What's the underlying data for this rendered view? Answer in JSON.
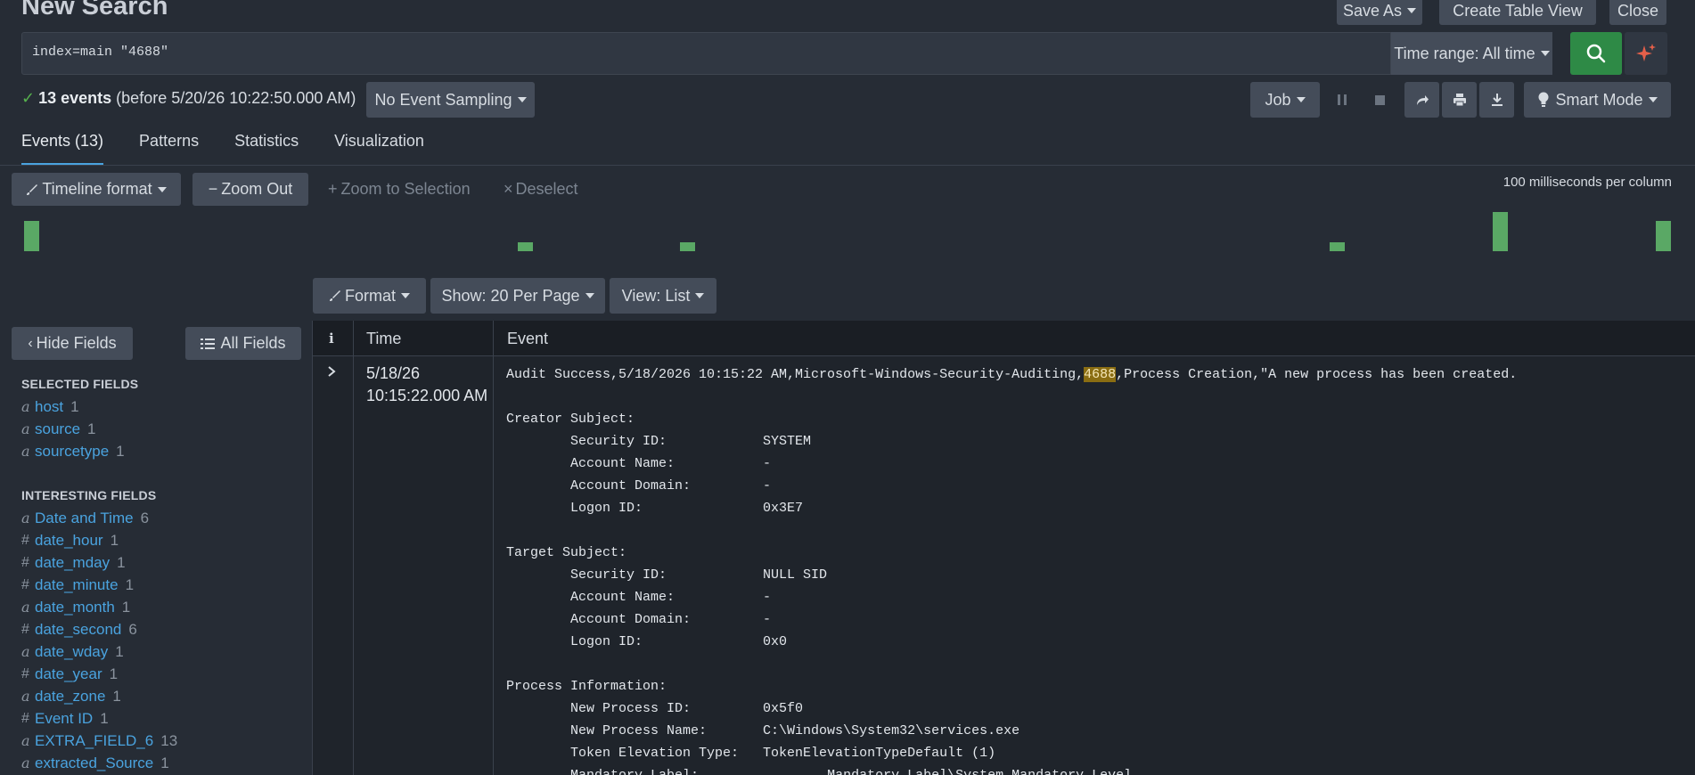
{
  "page": {
    "title": "New Search",
    "save_as": "Save As",
    "create_table_view": "Create Table View",
    "close": "Close"
  },
  "search": {
    "query": "index=main \"4688\"",
    "time_range": "Time range: All time"
  },
  "status": {
    "events_count": "13 events",
    "events_note": "(before 5/20/26 10:22:50.000 AM)",
    "sampling": "No Event Sampling",
    "job": "Job",
    "smart_mode": "Smart Mode"
  },
  "tabs": [
    {
      "label": "Events (13)",
      "active": true
    },
    {
      "label": "Patterns",
      "active": false
    },
    {
      "label": "Statistics",
      "active": false
    },
    {
      "label": "Visualization",
      "active": false
    }
  ],
  "timeline": {
    "format": "Timeline format",
    "zoom_out": "Zoom Out",
    "zoom_to_selection": "Zoom to Selection",
    "deselect": "Deselect",
    "scale_label": "100 milliseconds per column",
    "bars": [
      {
        "level": 1.0
      },
      {
        "level": 0.3
      },
      {
        "level": 0.3
      },
      {
        "level": 0.3
      },
      {
        "level": 1.3
      },
      {
        "level": 1.0
      }
    ]
  },
  "results_toolbar": {
    "format": "Format",
    "per_page": "Show: 20 Per Page",
    "view": "View: List"
  },
  "fields": {
    "hide_fields": "Hide Fields",
    "all_fields": "All Fields",
    "selected_header": "SELECTED FIELDS",
    "selected": [
      {
        "type": "a",
        "name": "host",
        "count": "1"
      },
      {
        "type": "a",
        "name": "source",
        "count": "1"
      },
      {
        "type": "a",
        "name": "sourcetype",
        "count": "1"
      }
    ],
    "interesting_header": "INTERESTING FIELDS",
    "interesting": [
      {
        "type": "a",
        "name": "Date and Time",
        "count": "6"
      },
      {
        "type": "#",
        "name": "date_hour",
        "count": "1"
      },
      {
        "type": "#",
        "name": "date_mday",
        "count": "1"
      },
      {
        "type": "#",
        "name": "date_minute",
        "count": "1"
      },
      {
        "type": "a",
        "name": "date_month",
        "count": "1"
      },
      {
        "type": "#",
        "name": "date_second",
        "count": "6"
      },
      {
        "type": "a",
        "name": "date_wday",
        "count": "1"
      },
      {
        "type": "#",
        "name": "date_year",
        "count": "1"
      },
      {
        "type": "a",
        "name": "date_zone",
        "count": "1"
      },
      {
        "type": "#",
        "name": "Event ID",
        "count": "1"
      },
      {
        "type": "a",
        "name": "EXTRA_FIELD_6",
        "count": "13"
      },
      {
        "type": "a",
        "name": "extracted_Source",
        "count": "1"
      }
    ]
  },
  "table": {
    "col_info": "i",
    "col_time": "Time",
    "col_event": "Event"
  },
  "event": {
    "date": "5/18/26",
    "time": "10:15:22.000 AM",
    "line1_pre": "Audit Success,5/18/2026 10:15:22 AM,Microsoft-Windows-Security-Auditing,",
    "line1_hl": "4688",
    "line1_post": ",Process Creation,\"A new process has been created.",
    "body": "\nCreator Subject:\n\tSecurity ID:\t\tSYSTEM\n\tAccount Name:\t\t-\n\tAccount Domain:\t\t-\n\tLogon ID:\t\t0x3E7\n\nTarget Subject:\n\tSecurity ID:\t\tNULL SID\n\tAccount Name:\t\t-\n\tAccount Domain:\t\t-\n\tLogon ID:\t\t0x0\n\nProcess Information:\n\tNew Process ID:\t\t0x5f0\n\tNew Process Name:\tC:\\Windows\\System32\\services.exe\n\tToken Elevation Type:\tTokenElevationTypeDefault (1)\n\tMandatory Label:\t\tMandatory Label\\System Mandatory Level"
  },
  "colors": {
    "background": "#262c35",
    "accent_blue": "#4aa3df",
    "go_green": "#2e8a46",
    "bar_green": "#5aa865",
    "highlight": "#8a6d12"
  }
}
